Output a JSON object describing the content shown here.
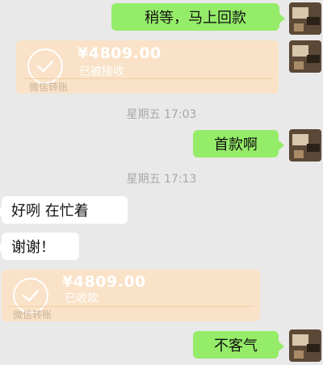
{
  "messages": {
    "m1": {
      "text": "稍等，马上回款"
    },
    "t1": {
      "amount": "¥4809.00",
      "status": "已被接收",
      "footer": "微信转账"
    },
    "ts1": {
      "text": "星期五 17:03"
    },
    "m2": {
      "text": "首款啊"
    },
    "ts2": {
      "text": "星期五 17:13"
    },
    "m3": {
      "text": "好咧 在忙着"
    },
    "m4": {
      "text": "谢谢！"
    },
    "t2": {
      "amount": "¥4809.00",
      "status": "已收款",
      "footer": "微信转账"
    },
    "m5": {
      "text": "不客气"
    }
  },
  "colors": {
    "sent_bubble": "#95ec69",
    "received_bubble": "#ffffff",
    "transfer_card": "#f9e2c7",
    "chat_background": "#e9e9e9"
  },
  "icons": {
    "transfer_status": "check-circle-icon",
    "avatar": "user-avatar"
  }
}
